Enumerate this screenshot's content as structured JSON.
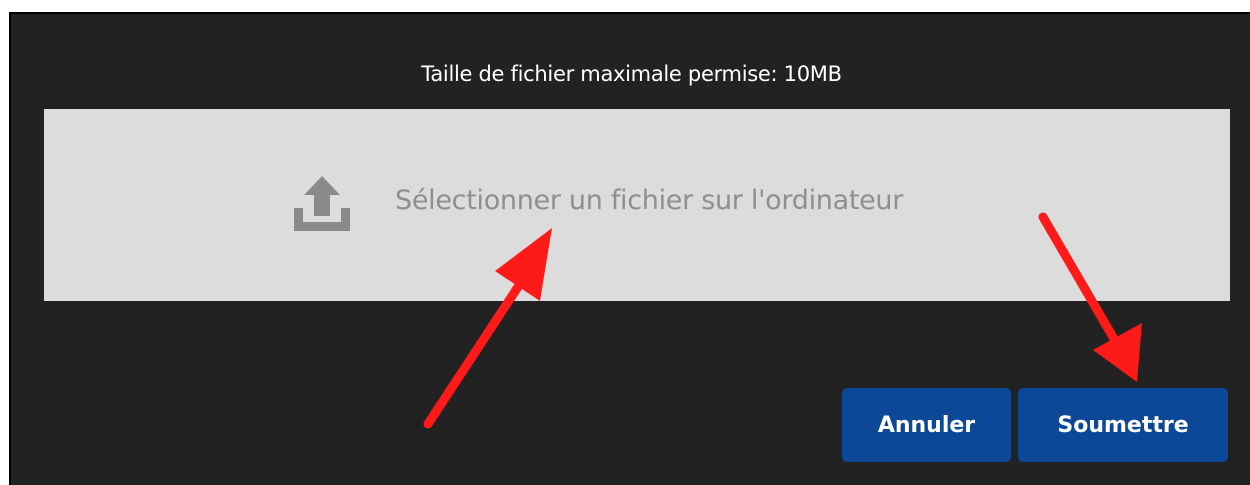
{
  "dialog": {
    "title": "Taille de fichier maximale permise: 10MB",
    "dropzone": {
      "icon": "upload-icon",
      "label": "Sélectionner un fichier sur l'ordinateur"
    },
    "buttons": {
      "cancel_label": "Annuler",
      "submit_label": "Soumettre"
    }
  },
  "colors": {
    "dialog_background": "#222222",
    "dropzone_background": "#dcdcdc",
    "button_background": "#0d4798",
    "annotation_arrow": "#ff1a1a"
  },
  "annotations": {
    "arrows": [
      "arrow-to-file-selector",
      "arrow-to-submit-button"
    ]
  }
}
